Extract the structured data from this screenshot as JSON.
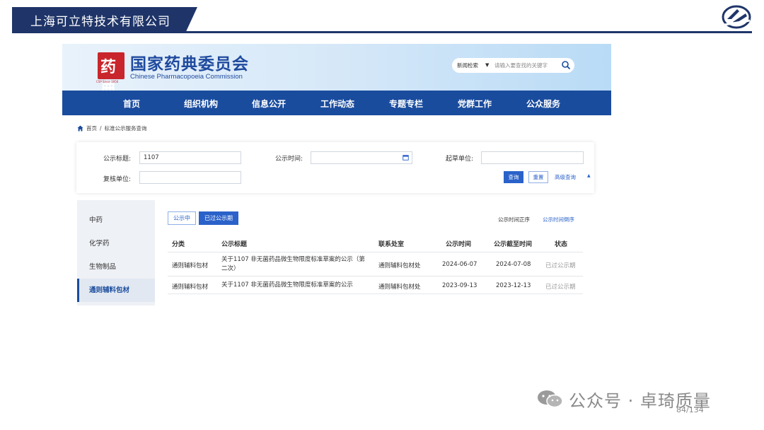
{
  "slide": {
    "title": "上海可立特技术有限公司",
    "page_number": "84/134",
    "watermark": "公众号 · 卓琦质量"
  },
  "site": {
    "name_zh": "国家药典委员会",
    "name_en": "Chinese Pharmacopoeia Commission",
    "seal_text": "药典",
    "seal_sub": "CSP Since 1950",
    "search": {
      "type": "新闻检索",
      "placeholder": "请输入要查找的关键字"
    },
    "nav": [
      "首页",
      "组织机构",
      "信息公开",
      "工作动态",
      "专题专栏",
      "党群工作",
      "公众服务"
    ],
    "breadcrumb": {
      "home": "首页",
      "separator": "/",
      "current": "标准公示服务查询"
    },
    "query": {
      "title_label": "公示标题:",
      "title_value": "1107",
      "time_label": "公示时间:",
      "time_value": "",
      "draft_label": "起草单位:",
      "draft_value": "",
      "review_label": "复核单位:",
      "review_value": "",
      "search_btn": "查询",
      "reset_btn": "重置",
      "advanced": "高级查询"
    },
    "sidebar": [
      "中药",
      "化学药",
      "生物制品",
      "通则辅料包材"
    ],
    "sidebar_active": 3,
    "tabs": {
      "open": "公示中",
      "closed": "已过公示期"
    },
    "sort": {
      "asc": "公示时间正序",
      "desc": "公示时间倒序"
    },
    "table": {
      "headers": [
        "分类",
        "公示标题",
        "联系处室",
        "公示时间",
        "公示截至时间",
        "状态"
      ],
      "rows": [
        {
          "category": "通则辅料包材",
          "title": "关于1107 非无菌药品微生物限度标准草案的公示（第二次）",
          "dept": "通则辅料包材处",
          "start": "2024-06-07",
          "end": "2024-07-08",
          "status": "已过公示期"
        },
        {
          "category": "通则辅料包材",
          "title": "关于1107 非无菌药品微生物限度标准草案的公示",
          "dept": "通则辅料包材处",
          "start": "2023-09-13",
          "end": "2023-12-13",
          "status": "已过公示期"
        }
      ]
    }
  },
  "colors": {
    "slide_navy": "#1f3569",
    "site_blue": "#1a4c9e",
    "button_blue": "#2a62c9",
    "seal_red": "#c9252c"
  }
}
